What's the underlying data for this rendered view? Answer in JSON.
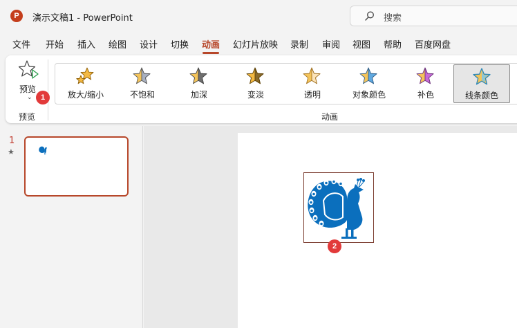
{
  "titlebar": {
    "logo": "P",
    "title": "演示文稿1  -  PowerPoint",
    "search_placeholder": "搜索"
  },
  "menu": {
    "tabs": [
      "文件",
      "开始",
      "插入",
      "绘图",
      "设计",
      "切换",
      "动画",
      "幻灯片放映",
      "录制",
      "审阅",
      "视图",
      "帮助",
      "百度网盘"
    ],
    "active_tab": "动画"
  },
  "ribbon": {
    "preview": {
      "label": "预览",
      "group_label": "预览"
    },
    "animations": {
      "group_label": "动画",
      "items": [
        {
          "label": "放大/缩小",
          "icon": "grow-shrink-star-icon",
          "color": "#f4b942"
        },
        {
          "label": "不饱和",
          "icon": "desaturate-star-icon",
          "color": "#a8b0c0"
        },
        {
          "label": "加深",
          "icon": "darken-star-icon",
          "color": "#6e6e6e"
        },
        {
          "label": "变淡",
          "icon": "lighten-star-icon",
          "color": "#8a6a2a"
        },
        {
          "label": "透明",
          "icon": "transparency-star-icon",
          "color": "#f8d49a"
        },
        {
          "label": "对象颜色",
          "icon": "object-color-star-icon",
          "color": "#5fa8e0"
        },
        {
          "label": "补色",
          "icon": "complementary-color-star-icon",
          "color": "#c86ad8"
        },
        {
          "label": "线条颜色",
          "icon": "line-color-star-icon",
          "color": "#7ec8e8"
        }
      ],
      "selected_index": 7
    }
  },
  "badges": {
    "first": "1",
    "second": "2"
  },
  "slides": {
    "number": "1",
    "star": "★"
  },
  "colors": {
    "accent": "#b7472a",
    "peacock": "#0b6fbd",
    "badge": "#e23a3a"
  }
}
